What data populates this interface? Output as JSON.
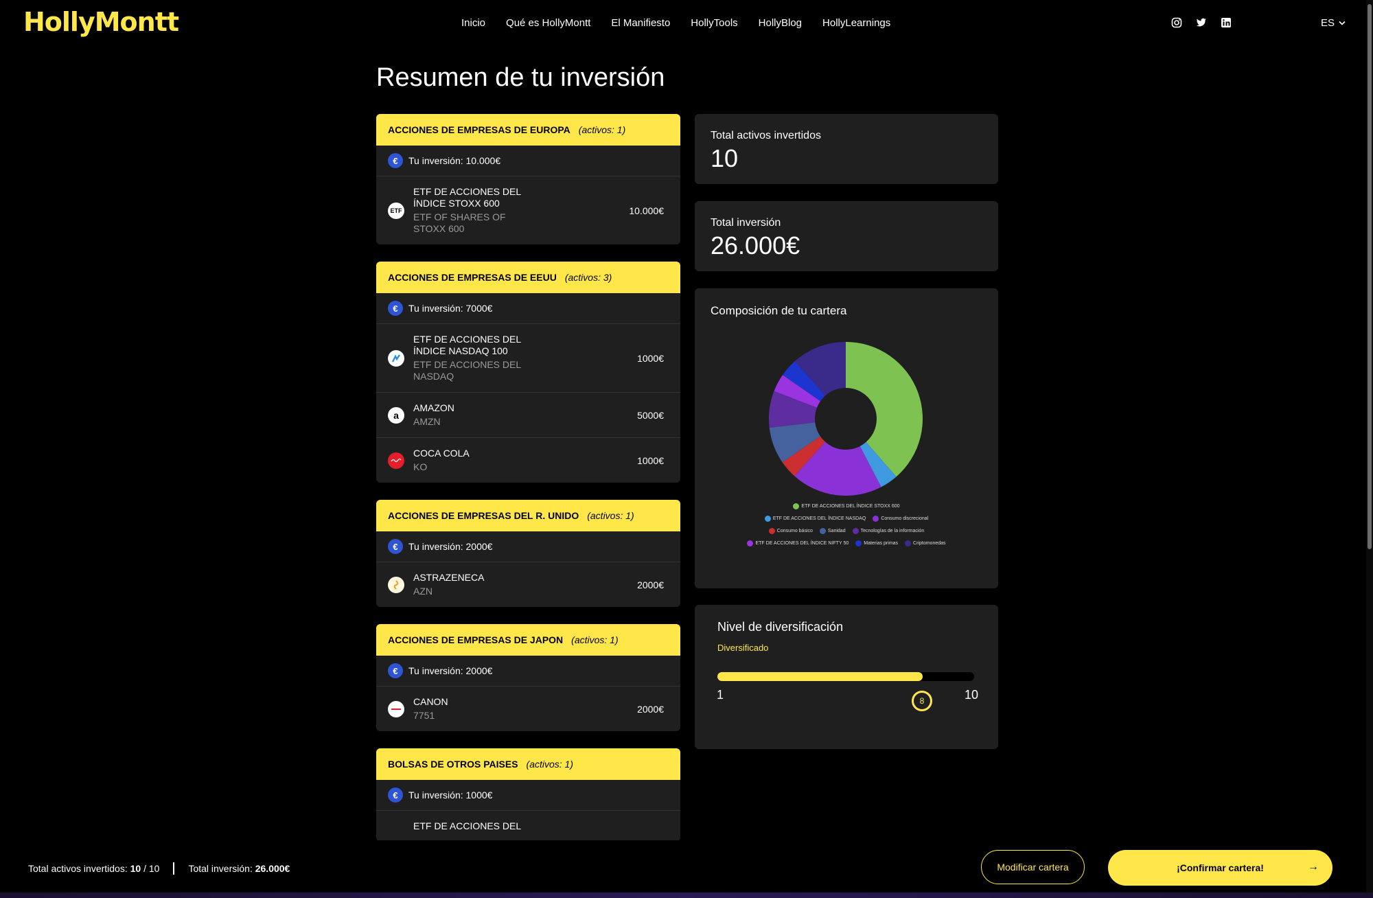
{
  "header": {
    "logo": "HollyMontt",
    "nav": [
      "Inicio",
      "Qué es HollyMontt",
      "El Manifiesto",
      "HollyTools",
      "HollyBlog",
      "HollyLearnings"
    ],
    "socials": [
      "instagram-icon",
      "twitter-icon",
      "linkedin-icon"
    ],
    "language": "ES"
  },
  "page_title": "Resumen de tu inversión",
  "groups": [
    {
      "title": "ACCIONES DE EMPRESAS DE EUROPA",
      "count": "(activos: 1)",
      "investment": "Tu inversión: 10.000€",
      "assets": [
        {
          "name": "ETF DE ACCIONES DEL ÍNDICE STOXX 600",
          "sub": "ETF OF SHARES OF STOXX 600",
          "value": "10.000€",
          "icon": "etf-icon",
          "icon_text": "ETF"
        }
      ]
    },
    {
      "title": "ACCIONES DE EMPRESAS DE EEUU",
      "count": "(activos: 3)",
      "investment": "Tu inversión: 7000€",
      "assets": [
        {
          "name": "ETF DE ACCIONES DEL ÍNDICE NASDAQ 100",
          "sub": "ETF DE ACCIONES DEL NASDAQ",
          "value": "1000€",
          "icon": "nasdaq-logo-icon",
          "icon_text": ""
        },
        {
          "name": "AMAZON",
          "sub": "AMZN",
          "value": "5000€",
          "icon": "amazon-logo-icon",
          "icon_text": "a"
        },
        {
          "name": "COCA COLA",
          "sub": "KO",
          "value": "1000€",
          "icon": "coca-cola-logo-icon",
          "icon_text": ""
        }
      ]
    },
    {
      "title": "ACCIONES DE EMPRESAS DEL R. UNIDO",
      "count": "(activos: 1)",
      "investment": "Tu inversión: 2000€",
      "assets": [
        {
          "name": "ASTRAZENECA",
          "sub": "AZN",
          "value": "2000€",
          "icon": "astrazeneca-logo-icon",
          "icon_text": ""
        }
      ]
    },
    {
      "title": "ACCIONES DE EMPRESAS DE JAPON",
      "count": "(activos: 1)",
      "investment": "Tu inversión: 2000€",
      "assets": [
        {
          "name": "CANON",
          "sub": "7751",
          "value": "2000€",
          "icon": "canon-logo-icon",
          "icon_text": ""
        }
      ]
    },
    {
      "title": "BOLSAS DE OTROS PAISES",
      "count": "(activos: 1)",
      "investment": "Tu inversión: 1000€",
      "assets": [
        {
          "name": "ETF DE ACCIONES DEL",
          "sub": "",
          "value": "",
          "icon": "",
          "icon_text": ""
        }
      ]
    }
  ],
  "summary": {
    "total_assets_label": "Total activos invertidos",
    "total_assets_value": "10",
    "total_investment_label": "Total inversión",
    "total_investment_value": "26.000€"
  },
  "composition": {
    "title": "Composición de tu cartera"
  },
  "chart_data": {
    "type": "pie",
    "title": "Composición de tu cartera",
    "categories": [
      "ETF DE ACCIONES DEL ÍNDICE STOXX 600",
      "ETF DE ACCIONES DEL ÍNDICE NASDAQ",
      "Consumo discrecional",
      "Consumo básico",
      "Sanidad",
      "Tecnologías de la información",
      "ETF DE ACCIONES DEL ÍNDICE NIFTY 50",
      "Materias primas",
      "Criptomonedas"
    ],
    "values": [
      38.5,
      3.8,
      19.2,
      3.8,
      7.7,
      7.7,
      3.8,
      3.8,
      11.5
    ],
    "colors": [
      "#7ec352",
      "#3f9ae0",
      "#8a32d6",
      "#cc2f2f",
      "#45619e",
      "#5e2ea0",
      "#9a33e0",
      "#1d35cf",
      "#3a2a8a"
    ],
    "legend_position": "bottom",
    "donut": true
  },
  "diversification": {
    "title": "Nivel de diversificación",
    "status": "Diversificado",
    "min": "1",
    "max": "10",
    "value": 8,
    "value_label": "8"
  },
  "footer": {
    "assets_label": "Total activos invertidos: ",
    "assets_value": "10",
    "assets_total": " / 10",
    "investment_label": "Total inversión: ",
    "investment_value": "26.000€",
    "modify_label": "Modificar cartera",
    "confirm_label": "¡Confirmar cartera!"
  }
}
